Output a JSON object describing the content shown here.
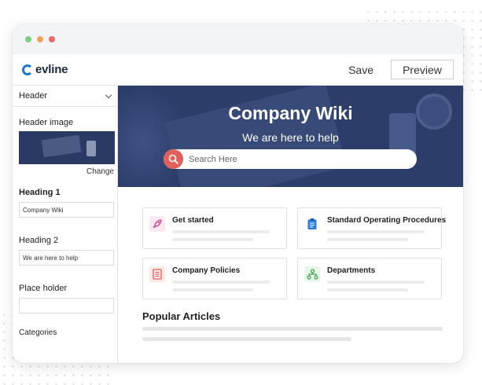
{
  "app": {
    "logo_text": "evline"
  },
  "toolbar": {
    "save_label": "Save",
    "preview_label": "Preview"
  },
  "sidebar": {
    "section": "Header",
    "header_image_label": "Header image",
    "change_label": "Change",
    "heading1_label": "Heading 1",
    "heading1_value": "Company Wiki",
    "heading2_label": "Heading 2",
    "heading2_value": "We are here to help",
    "placeholder_label": "Place holder",
    "placeholder_value": "",
    "categories_label": "Categories"
  },
  "hero": {
    "title": "Company Wiki",
    "subtitle": "We are here to help",
    "search_placeholder": "Search Here"
  },
  "categories": [
    {
      "title": "Get started",
      "icon": "rocket-icon",
      "color": "#d23a8c",
      "bg": "#fbe9f2"
    },
    {
      "title": "Standard Operating Procedures",
      "icon": "clipboard-icon",
      "color": "#2b7de0",
      "bg": "#ffffff"
    },
    {
      "title": "Company Policies",
      "icon": "document-icon",
      "color": "#e0605b",
      "bg": "#fde8e6"
    },
    {
      "title": "Departments",
      "icon": "hierarchy-icon",
      "color": "#3aa14a",
      "bg": "#e9f6ea"
    }
  ],
  "popular": {
    "title": "Popular Articles"
  },
  "colors": {
    "accent": "#2c3d6a",
    "brand": "#1f7ad1",
    "search": "#e0605b"
  }
}
